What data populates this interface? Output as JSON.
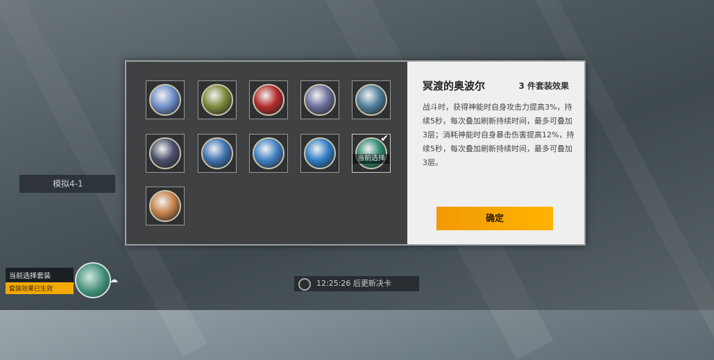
{
  "stage": {
    "caption": "",
    "label": "模拟4-1"
  },
  "set_badge": {
    "name": "当前选择套装",
    "sub": "套装效果已生效"
  },
  "timer": {
    "text": "12:25:26 后更新决卡"
  },
  "dialog": {
    "slots": [
      {
        "icon": "wave-crest-emblem",
        "color": "#6f8fc8"
      },
      {
        "icon": "spartan-helmet-emblem",
        "color": "#7c8a3c"
      },
      {
        "icon": "sun-banner-emblem",
        "color": "#b32b2b"
      },
      {
        "icon": "spear-ring-emblem",
        "color": "#6a6f9c"
      },
      {
        "icon": "temple-emblem",
        "color": "#4f7e9a"
      },
      {
        "icon": "pillars-emblem",
        "color": "#4b4f6b"
      },
      {
        "icon": "swan-star-emblem",
        "color": "#3f73b0"
      },
      {
        "icon": "crystal-emblem",
        "color": "#3f82c4"
      },
      {
        "icon": "whale-emblem",
        "color": "#2f7fc6"
      },
      {
        "icon": "dolphin-emblem",
        "color": "#2f8a73",
        "selected": true,
        "tag": "当前选择"
      },
      {
        "icon": "phoenix-emblem",
        "color": "#c6824a"
      }
    ],
    "title": "冥渡的奥波尔",
    "effect_label": "3 件套装效果",
    "description": "战斗时，获得神能时自身攻击力提高3%，持续5秒，每次叠加刷新持续时间，最多可叠加3层；消耗神能时自身暴击伤害提高12%，持续5秒，每次叠加刷新持续时间，最多可叠加3层。",
    "confirm_label": "确定"
  }
}
